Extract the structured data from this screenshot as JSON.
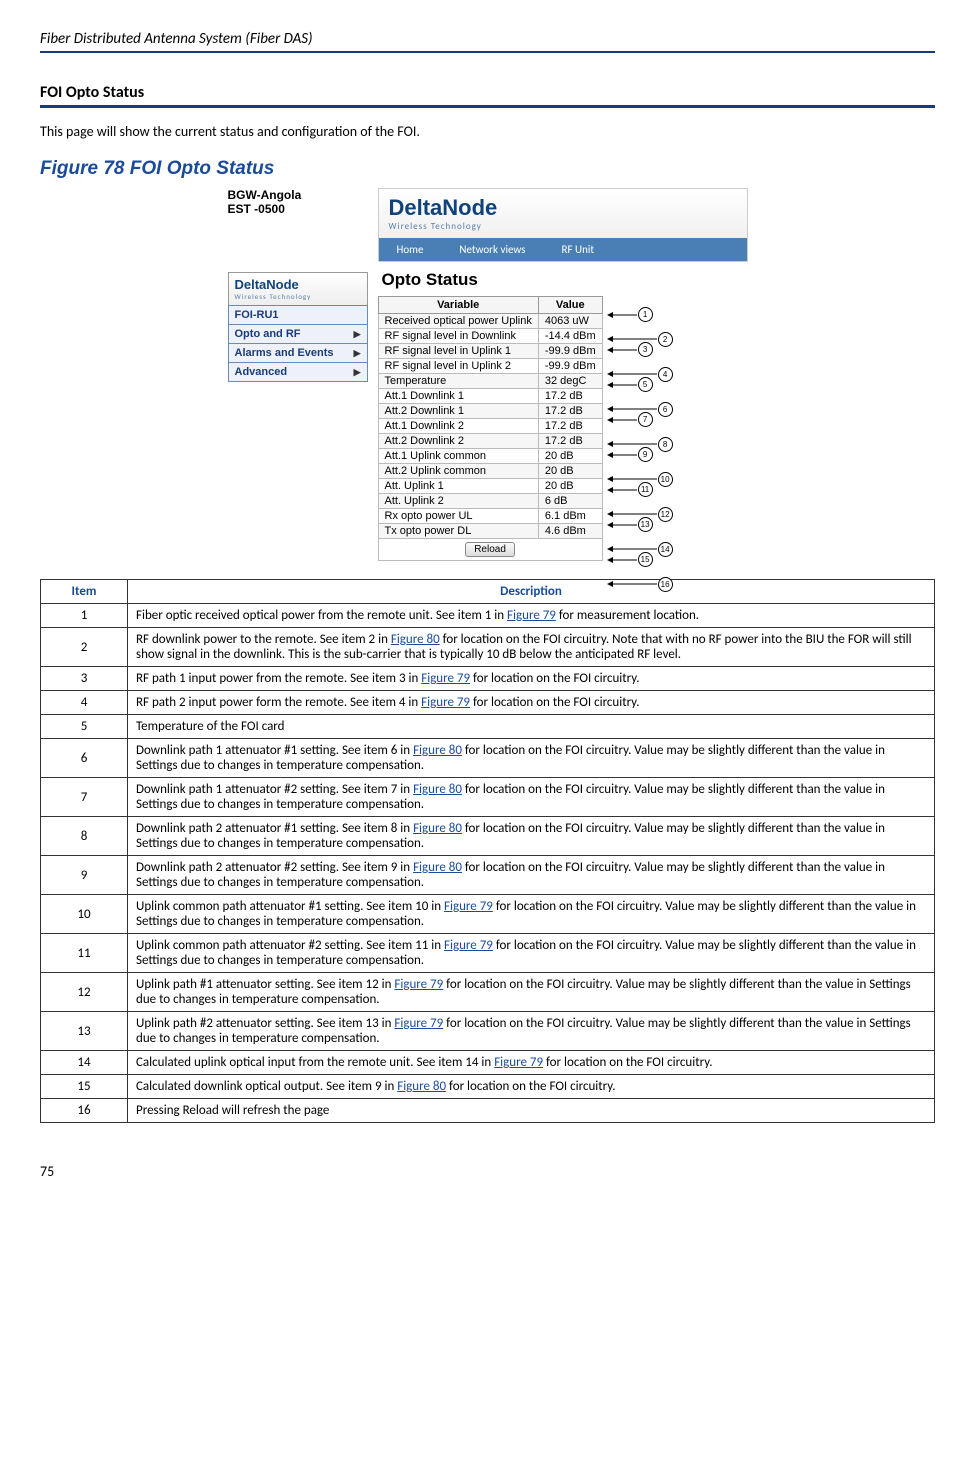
{
  "header": "Fiber Distributed Antenna System (Fiber DAS)",
  "section_title": "FOI Opto Status",
  "intro": "This page will show the current status and configuration of the FOI.",
  "figure_label": "Figure 78    FOI Opto Status",
  "bgw": "BGW-Angola\nEST -0500",
  "brand": "DeltaNode",
  "brand_sub": "Wireless   Technology",
  "side_menu": [
    "FOI-RU1",
    "Opto and RF",
    "Alarms and Events",
    "Advanced"
  ],
  "nav": [
    "Home",
    "Network views",
    "RF Unit"
  ],
  "opto_title": "Opto Status",
  "status_header": {
    "var": "Variable",
    "val": "Value"
  },
  "status_rows": [
    {
      "var": "Received optical power Uplink",
      "val": "4063 uW"
    },
    {
      "var": "RF signal level in Downlink",
      "val": "-14.4 dBm"
    },
    {
      "var": "RF signal level in Uplink 1",
      "val": "-99.9 dBm"
    },
    {
      "var": "RF signal level in Uplink 2",
      "val": "-99.9 dBm"
    },
    {
      "var": "Temperature",
      "val": "32 degC"
    },
    {
      "var": "Att.1 Downlink 1",
      "val": "17.2 dB"
    },
    {
      "var": "Att.2 Downlink 1",
      "val": "17.2 dB"
    },
    {
      "var": "Att.1 Downlink 2",
      "val": "17.2 dB"
    },
    {
      "var": "Att.2 Downlink 2",
      "val": "17.2 dB"
    },
    {
      "var": "Att.1 Uplink common",
      "val": "20 dB"
    },
    {
      "var": "Att.2 Uplink common",
      "val": "20 dB"
    },
    {
      "var": "Att. Uplink 1",
      "val": "20 dB"
    },
    {
      "var": "Att. Uplink 2",
      "val": "6 dB"
    },
    {
      "var": "Rx opto power UL",
      "val": "6.1 dBm"
    },
    {
      "var": "Tx opto power DL",
      "val": "4.6 dBm"
    }
  ],
  "reload": "Reload",
  "desc_header": {
    "item": "Item",
    "desc": "Description"
  },
  "desc_rows": [
    {
      "n": "1",
      "pre": "Fiber optic received optical power from the remote unit. See item 1 in ",
      "link": "Figure 79",
      "post": " for measurement location."
    },
    {
      "n": "2",
      "pre": "RF downlink power to the remote. See item 2 in ",
      "link": "Figure 80",
      "post": " for location on the FOI circuitry. Note that with no RF power into the BIU the FOR will still show signal in the downlink. This is the sub-carrier that is typically 10 dB below the anticipated RF level."
    },
    {
      "n": "3",
      "pre": "RF path 1 input power from the remote. See item 3 in ",
      "link": "Figure 79",
      "post": " for location on the FOI circuitry."
    },
    {
      "n": "4",
      "pre": "RF path 2 input power form the remote. See item 4 in ",
      "link": "Figure 79",
      "post": " for location on the FOI circuitry."
    },
    {
      "n": "5",
      "pre": "Temperature of the FOI card",
      "link": "",
      "post": ""
    },
    {
      "n": "6",
      "pre": "Downlink path 1 attenuator #1 setting. See item 6 in ",
      "link": "Figure 80",
      "post": " for location on the FOI circuitry. Value may be slightly different than the value in Settings due to changes in temperature compensation."
    },
    {
      "n": "7",
      "pre": "Downlink path 1 attenuator #2 setting. See item 7 in ",
      "link": "Figure 80",
      "post": " for location on the FOI circuitry. Value may be slightly different than the value in Settings due to changes in temperature compensation."
    },
    {
      "n": "8",
      "pre": "Downlink path 2 attenuator #1 setting. See item 8 in ",
      "link": "Figure 80",
      "post": " for location on the FOI circuitry. Value may be slightly different than the value in Settings due to changes in temperature compensation."
    },
    {
      "n": "9",
      "pre": "Downlink path 2 attenuator #2 setting. See item 9 in ",
      "link": "Figure 80",
      "post": " for location on the FOI circuitry. Value may be slightly different than the value in Settings due to changes in temperature compensation."
    },
    {
      "n": "10",
      "pre": "Uplink common path attenuator #1 setting. See item 10 in ",
      "link": "Figure 79",
      "post": " for location on the FOI circuitry. Value may be slightly different than the value in Settings due to changes in temperature compensation."
    },
    {
      "n": "11",
      "pre": "Uplink common path attenuator #2 setting. See item 11 in ",
      "link": "Figure 79",
      "post": " for location on the FOI circuitry. Value may be slightly different than the value in Settings due to changes in temperature compensation."
    },
    {
      "n": "12",
      "pre": "Uplink path #1 attenuator setting. See item 12 in ",
      "link": "Figure 79",
      "post": " for location on the FOI circuitry. Value may be slightly different than the value in Settings due to changes in temperature compensation."
    },
    {
      "n": "13",
      "pre": "Uplink path #2 attenuator setting. See item 13 in ",
      "link": "Figure 79",
      "post": " for location on the FOI circuitry. Value may be slightly different than the value in Settings due to changes in temperature compensation."
    },
    {
      "n": "14",
      "pre": "Calculated uplink optical input from the remote unit. See item 14 in ",
      "link": "Figure 79",
      "post": " for location on the FOI circuitry."
    },
    {
      "n": "15",
      "pre": "Calculated downlink optical output. See item 9 in ",
      "link": "Figure 80",
      "post": " for location on the FOI circuitry."
    },
    {
      "n": "16",
      "pre": "Pressing Reload will refresh the page",
      "link": "",
      "post": ""
    }
  ],
  "page_num": "75"
}
